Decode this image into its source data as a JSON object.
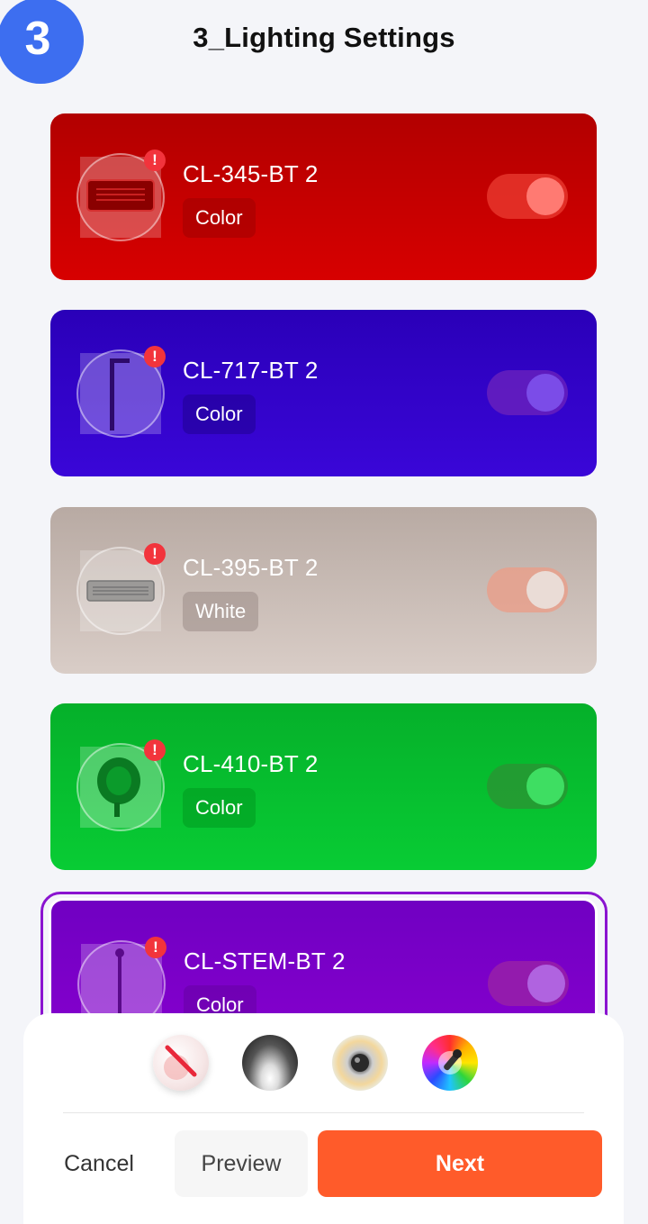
{
  "header": {
    "step_number": "3",
    "title": "3_Lighting Settings"
  },
  "lights": [
    {
      "name": "CL-345-BT 2",
      "mode": "Color",
      "alert": "!",
      "color": "#d80000",
      "enabled": true
    },
    {
      "name": "CL-717-BT 2",
      "mode": "Color",
      "alert": "!",
      "color": "#3200cc",
      "enabled": true
    },
    {
      "name": "CL-395-BT 2",
      "mode": "White",
      "alert": "!",
      "color": "#cdbfb8",
      "enabled": true
    },
    {
      "name": "CL-410-BT 2",
      "mode": "Color",
      "alert": "!",
      "color": "#06c42e",
      "enabled": true
    },
    {
      "name": "CL-STEM-BT 2",
      "mode": "Color",
      "alert": "!",
      "color": "#7d00c8",
      "enabled": true,
      "selected": true
    }
  ],
  "effects": [
    "off-effect-icon",
    "spotlight-effect-icon",
    "lens-effect-icon",
    "color-picker-effect-icon"
  ],
  "actions": {
    "cancel": "Cancel",
    "preview": "Preview",
    "next": "Next"
  },
  "colors": {
    "accent": "#ff5b2a",
    "step_badge": "#3d6ef0",
    "alert": "#f2343c"
  }
}
